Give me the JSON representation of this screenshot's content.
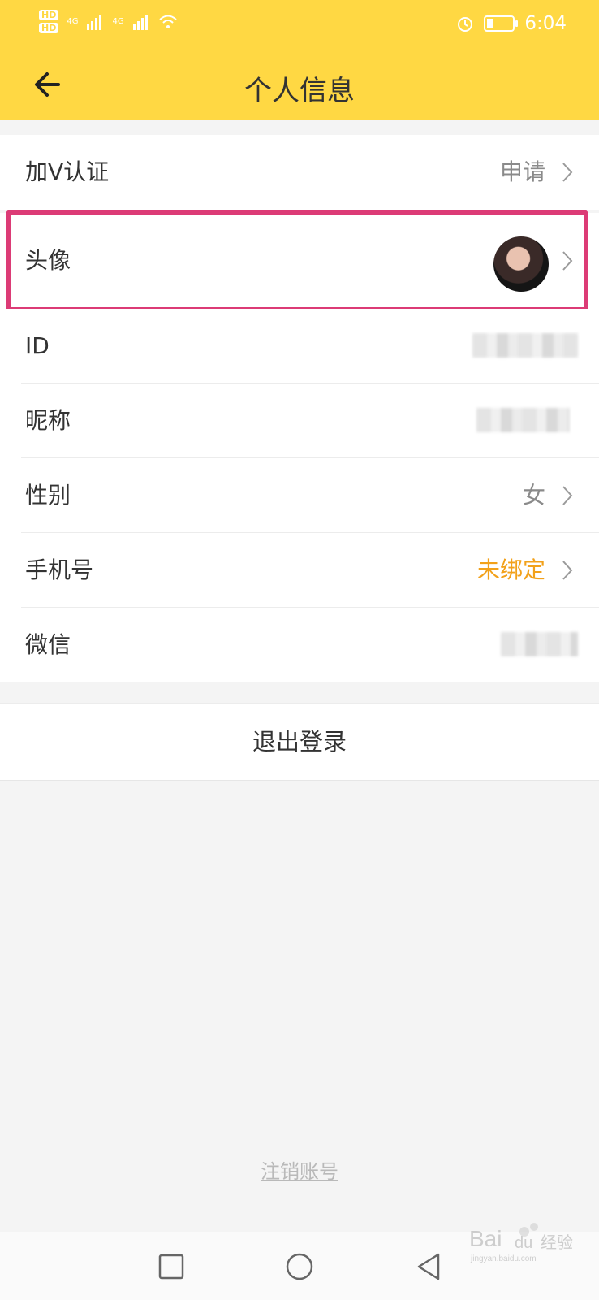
{
  "colors": {
    "header_bg": "#ffd843",
    "page_bg": "#f4f4f4",
    "highlight": "#dc3b76",
    "warn_value": "#f2a11a",
    "value_gray": "#8a8a8a"
  },
  "status_bar": {
    "hd_badges": [
      "HD",
      "HD"
    ],
    "network": [
      "4G",
      "4G"
    ],
    "time": "6:04",
    "icons": [
      "signal-icon",
      "wifi-icon",
      "alarm-icon",
      "battery-icon"
    ]
  },
  "header": {
    "title": "个人信息",
    "back_icon": "back-arrow-icon"
  },
  "rows": {
    "verify": {
      "label": "加V认证",
      "value": "申请"
    },
    "avatar": {
      "label": "头像"
    },
    "id": {
      "label": "ID",
      "value_note": "blurred"
    },
    "nickname": {
      "label": "昵称",
      "value_note": "blurred"
    },
    "gender": {
      "label": "性别",
      "value": "女"
    },
    "phone": {
      "label": "手机号",
      "value": "未绑定"
    },
    "wechat": {
      "label": "微信",
      "value_note": "blurred"
    }
  },
  "logout": {
    "label": "退出登录"
  },
  "cancel_account": {
    "label": "注销账号"
  },
  "nav_bar": {
    "buttons": [
      "recent-apps-icon",
      "home-icon",
      "back-triangle-icon"
    ]
  }
}
